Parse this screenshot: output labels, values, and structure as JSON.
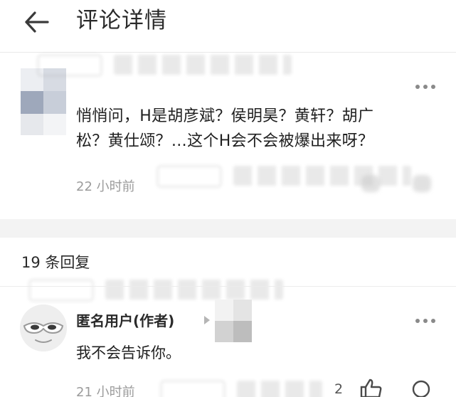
{
  "header": {
    "title": "评论详情",
    "back_icon": "arrow-left-icon"
  },
  "comment": {
    "text": "悄悄问，H是胡彦斌？侯明昊？黄轩？胡广\n松？黄仕颂？…这个H会不会被爆出来呀？",
    "time": "22 小时前",
    "more_icon": "more-dots-icon"
  },
  "replies": {
    "count_label": "19 条回复",
    "items": [
      {
        "author": "匿名用户(作者)",
        "text": "我不会告诉你。",
        "time": "21 小时前",
        "likes": "2",
        "more_icon": "more-dots-icon"
      }
    ]
  },
  "colors": {
    "text_primary": "#202020",
    "text_secondary": "#9b9b9b",
    "separator_band": "#f3f3f3",
    "divider": "#e9e9e9"
  }
}
